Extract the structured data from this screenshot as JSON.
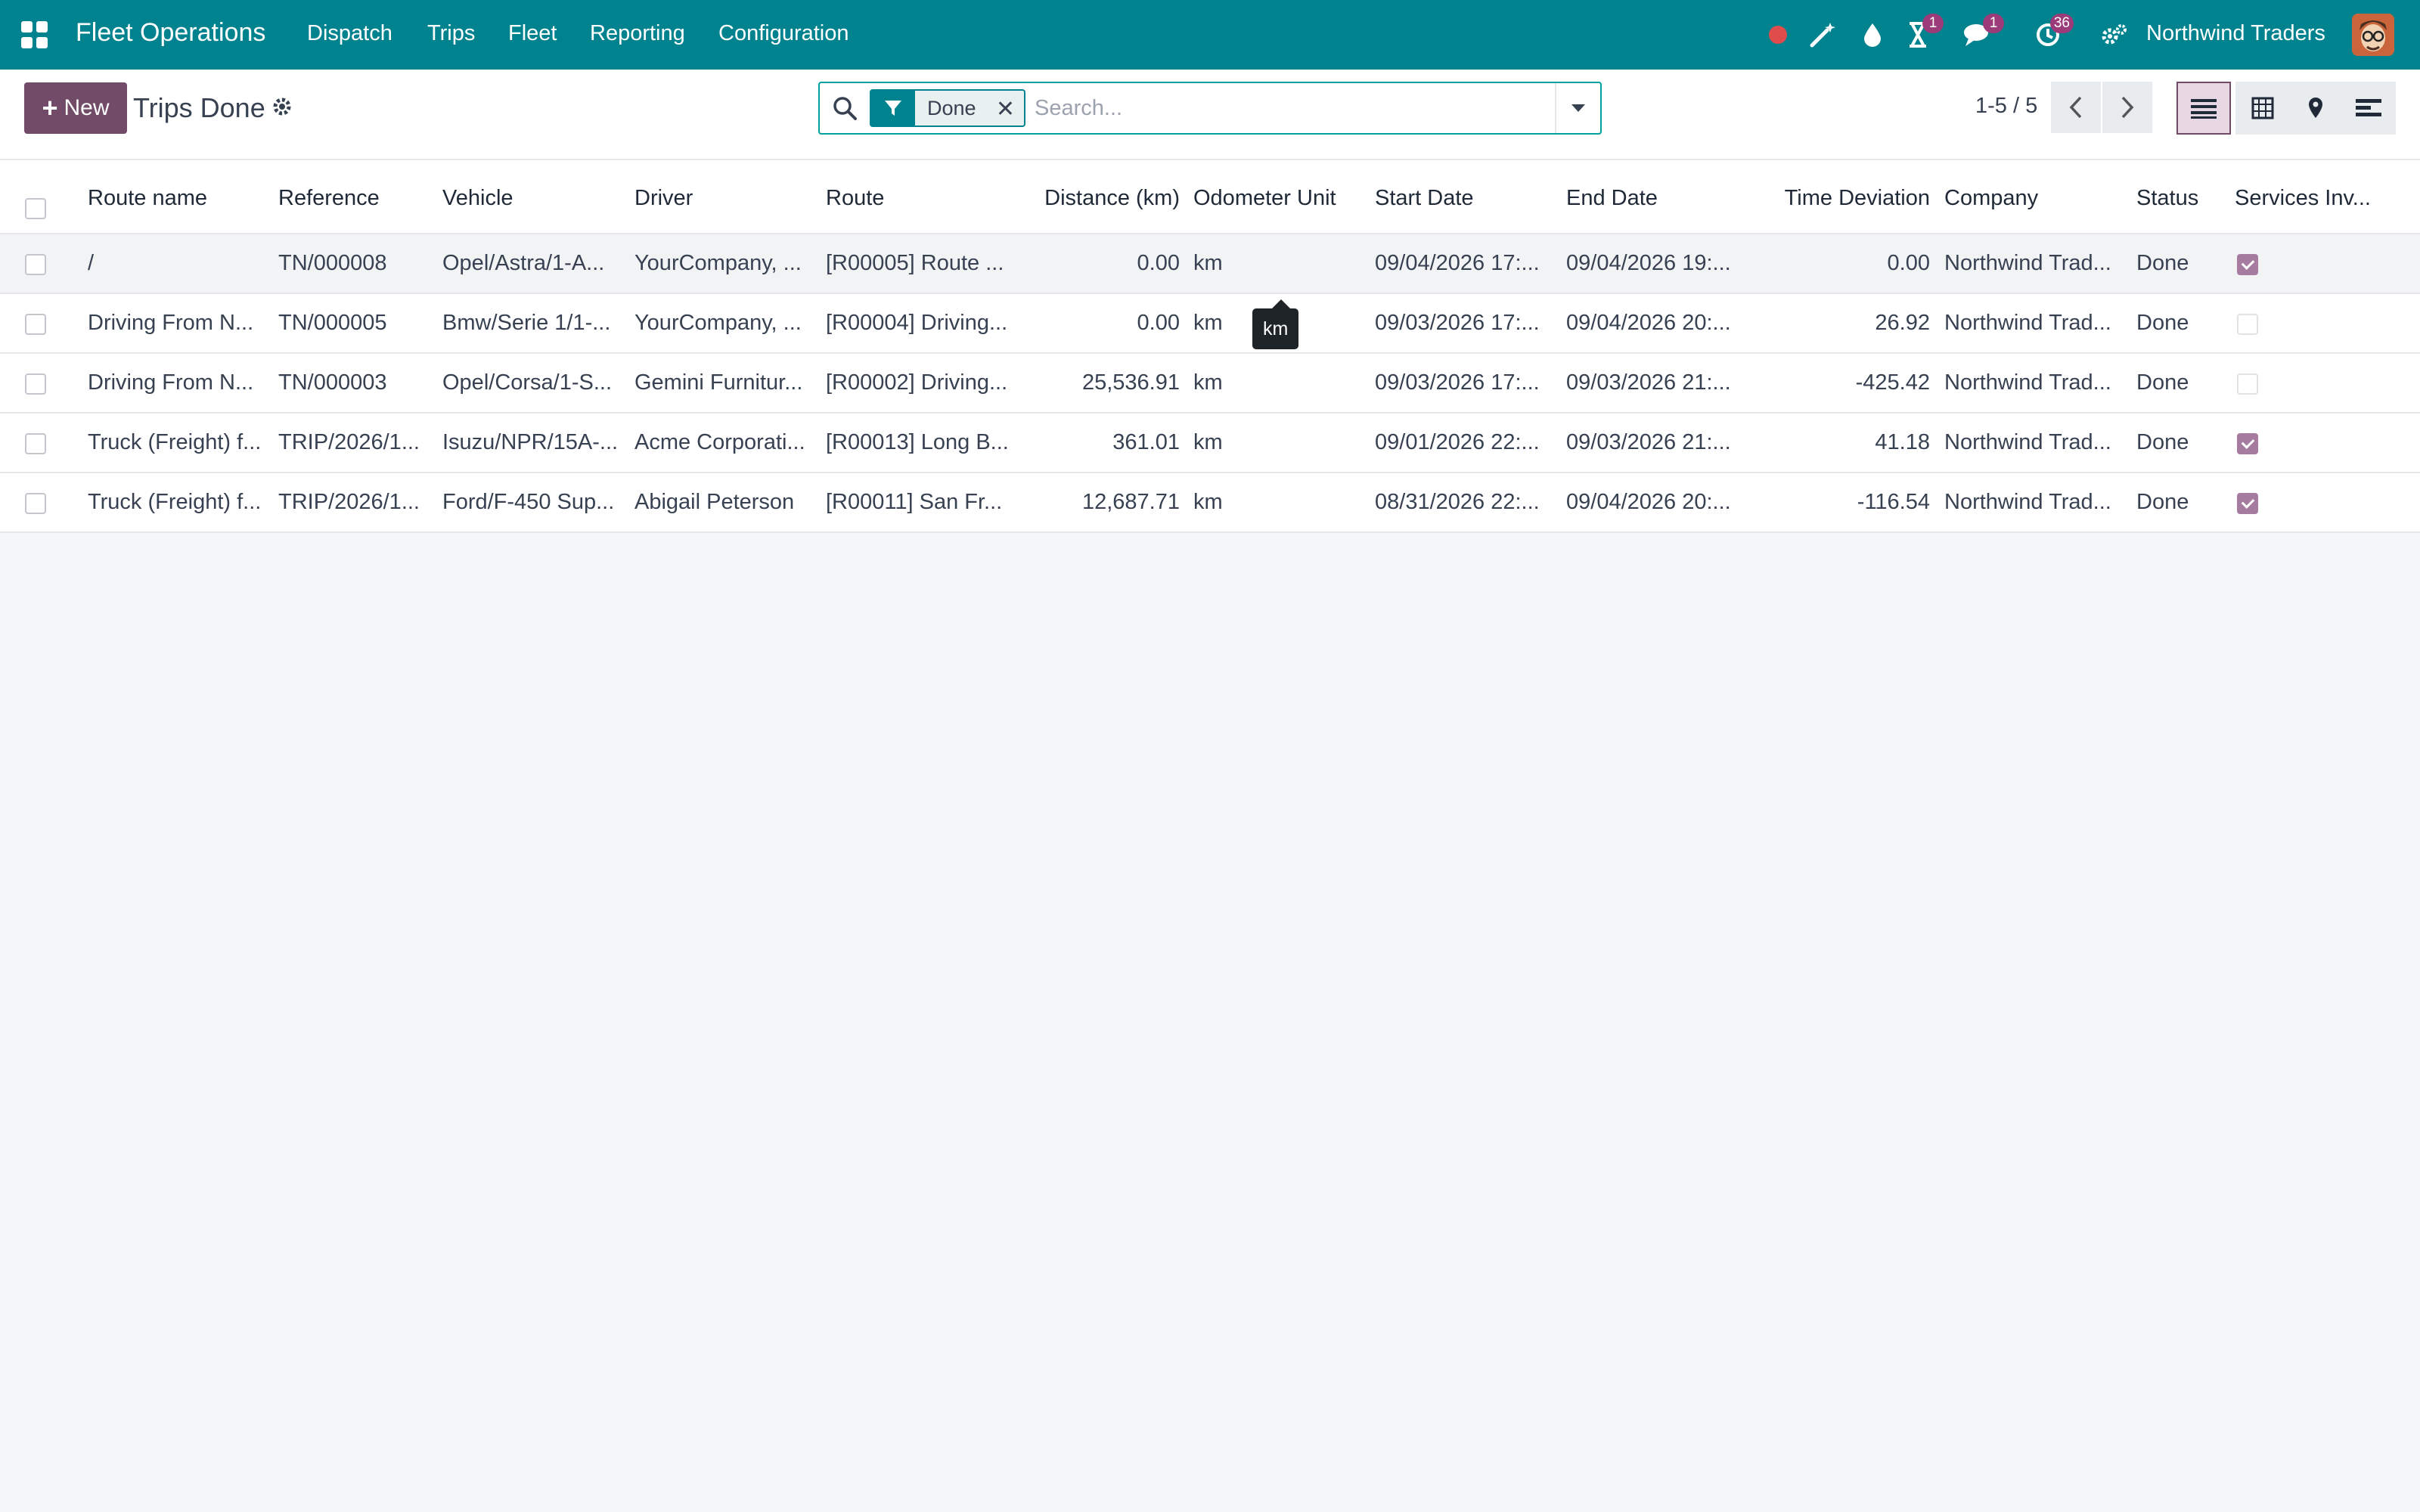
{
  "nav": {
    "app_name": "Fleet Operations",
    "menu": [
      "Dispatch",
      "Trips",
      "Fleet",
      "Reporting",
      "Configuration"
    ],
    "company": "Northwind Traders",
    "activity_badge": "1",
    "messages_badge": "1",
    "timer_badge": "36"
  },
  "control": {
    "new_label": "New",
    "title": "Trips Done",
    "facet_label": "Done",
    "search_placeholder": "Search...",
    "pager": "1-5 / 5"
  },
  "table": {
    "columns": [
      "Route name",
      "Reference",
      "Vehicle",
      "Driver",
      "Route",
      "Distance (km)",
      "Odometer Unit",
      "Start Date",
      "End Date",
      "Time Deviation",
      "Company",
      "Status",
      "Services Inv..."
    ],
    "rows": [
      {
        "route_name": "/",
        "reference": "TN/000008",
        "vehicle": "Opel/Astra/1-A...",
        "driver": "YourCompany, ...",
        "route": "[R00005] Route ...",
        "distance": "0.00",
        "unit": "km",
        "start": "09/04/2026 17:...",
        "end": "09/04/2026 19:...",
        "deviation": "0.00",
        "company": "Northwind Trad...",
        "status": "Done",
        "invoiced": true
      },
      {
        "route_name": "Driving From N...",
        "reference": "TN/000005",
        "vehicle": "Bmw/Serie 1/1-...",
        "driver": "YourCompany, ...",
        "route": "[R00004] Driving...",
        "distance": "0.00",
        "unit": "km",
        "start": "09/03/2026 17:...",
        "end": "09/04/2026 20:...",
        "deviation": "26.92",
        "company": "Northwind Trad...",
        "status": "Done",
        "invoiced": false
      },
      {
        "route_name": "Driving From N...",
        "reference": "TN/000003",
        "vehicle": "Opel/Corsa/1-S...",
        "driver": "Gemini Furnitur...",
        "route": "[R00002] Driving...",
        "distance": "25,536.91",
        "unit": "km",
        "start": "09/03/2026 17:...",
        "end": "09/03/2026 21:...",
        "deviation": "-425.42",
        "company": "Northwind Trad...",
        "status": "Done",
        "invoiced": false
      },
      {
        "route_name": "Truck (Freight) f...",
        "reference": "TRIP/2026/1...",
        "vehicle": "Isuzu/NPR/15A-...",
        "driver": "Acme Corporati...",
        "route": "[R00013] Long B...",
        "distance": "361.01",
        "unit": "km",
        "start": "09/01/2026 22:...",
        "end": "09/03/2026 21:...",
        "deviation": "41.18",
        "company": "Northwind Trad...",
        "status": "Done",
        "invoiced": true
      },
      {
        "route_name": "Truck (Freight) f...",
        "reference": "TRIP/2026/1...",
        "vehicle": "Ford/F-450 Sup...",
        "driver": "Abigail Peterson",
        "route": "[R00011] San Fr...",
        "distance": "12,687.71",
        "unit": "km",
        "start": "08/31/2026 22:...",
        "end": "09/04/2026 20:...",
        "deviation": "-116.54",
        "company": "Northwind Trad...",
        "status": "Done",
        "invoiced": true
      }
    ]
  },
  "tooltip": "km"
}
